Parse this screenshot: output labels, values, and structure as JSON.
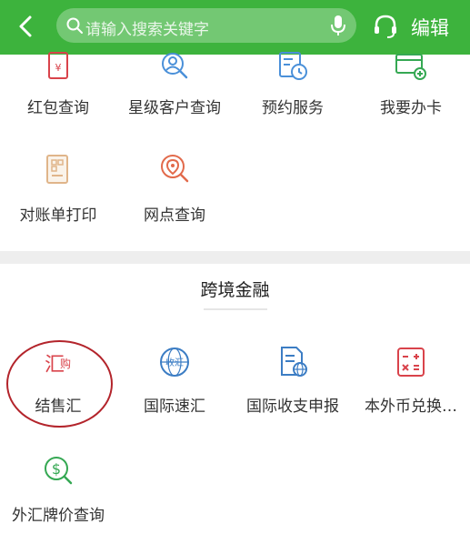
{
  "header": {
    "search_placeholder": "请输入搜索关键字",
    "edit_label": "编辑",
    "icons": [
      "back-icon",
      "search-icon",
      "microphone-icon",
      "headset-icon"
    ],
    "color": "#3db33d"
  },
  "services": [
    {
      "label": "红包查询",
      "icon": "red-envelope-icon"
    },
    {
      "label": "星级客户查询",
      "icon": "customer-search-icon"
    },
    {
      "label": "预约服务",
      "icon": "calendar-clock-icon"
    },
    {
      "label": "我要办卡",
      "icon": "card-add-icon"
    },
    {
      "label": "对账单打印",
      "icon": "statement-print-icon"
    },
    {
      "label": "网点查询",
      "icon": "location-search-icon"
    }
  ],
  "cross_border": {
    "title": "跨境金融",
    "items": [
      {
        "label": "结售汇",
        "icon": "exchange-settlement-icon",
        "glyph_a": "汇",
        "glyph_b": "购"
      },
      {
        "label": "国际速汇",
        "icon": "globe-remit-icon",
        "glyph": "收汇"
      },
      {
        "label": "国际收支申报",
        "icon": "document-globe-icon"
      },
      {
        "label": "本外币兑换…",
        "icon": "calculator-icon"
      },
      {
        "label": "外汇牌价查询",
        "icon": "dollar-search-icon"
      }
    ]
  }
}
